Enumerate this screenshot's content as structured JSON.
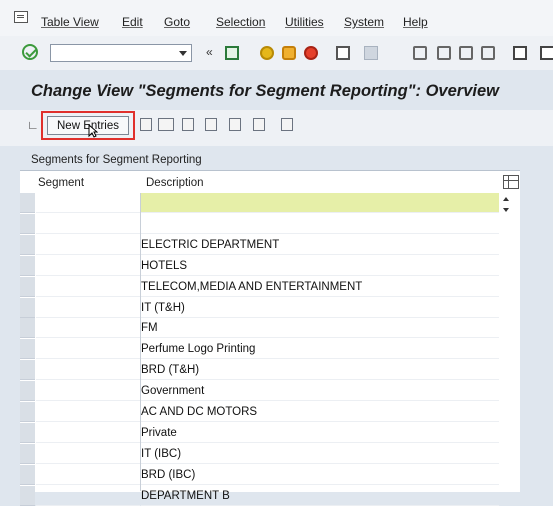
{
  "menu": {
    "items": [
      "Table View",
      "Edit",
      "Goto",
      "Selection",
      "Utilities",
      "System",
      "Help"
    ]
  },
  "toolbar": {
    "command_field_value": "",
    "collapse_glyph": "«"
  },
  "header": {
    "title": "Change View \"Segments for Segment Reporting\": Overview"
  },
  "app_toolbar": {
    "new_entries_label": "New Entries"
  },
  "table": {
    "caption": "Segments for Segment Reporting",
    "columns": [
      "Segment",
      "Description"
    ],
    "rows": [
      {
        "segment": "",
        "description": ""
      },
      {
        "segment": "",
        "description": ""
      },
      {
        "segment": "",
        "description": "ELECTRIC DEPARTMENT"
      },
      {
        "segment": "",
        "description": "HOTELS"
      },
      {
        "segment": "",
        "description": "TELECOM,MEDIA AND ENTERTAINMENT"
      },
      {
        "segment": "",
        "description": "IT (T&H)"
      },
      {
        "segment": "",
        "description": "FM"
      },
      {
        "segment": "",
        "description": "Perfume Logo Printing"
      },
      {
        "segment": "",
        "description": "BRD (T&H)"
      },
      {
        "segment": "",
        "description": "Government"
      },
      {
        "segment": "",
        "description": "AC AND DC MOTORS"
      },
      {
        "segment": "",
        "description": "Private"
      },
      {
        "segment": "",
        "description": "IT (IBC)"
      },
      {
        "segment": "",
        "description": "BRD (IBC)"
      },
      {
        "segment": "",
        "description": "DEPARTMENT B"
      }
    ]
  },
  "colors": {
    "highlight_row": "#e6efa8",
    "focus_border": "#e0302c"
  }
}
